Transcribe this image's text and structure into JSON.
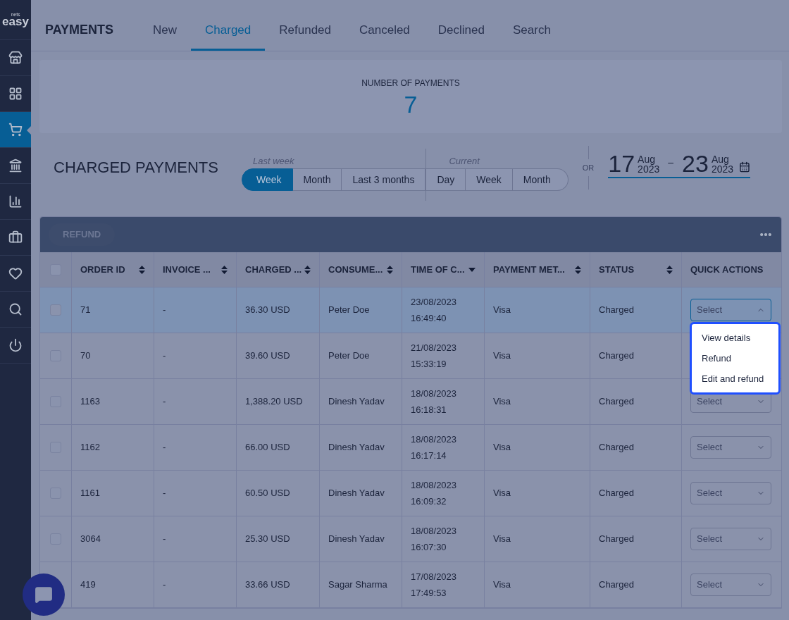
{
  "logo": {
    "small": "nets",
    "main": "easy"
  },
  "sidebar": {
    "items": [
      {
        "kind": "store",
        "selected": false
      },
      {
        "kind": "grid",
        "selected": false
      },
      {
        "kind": "cart",
        "selected": true
      },
      {
        "kind": "bank",
        "selected": false
      },
      {
        "kind": "chart",
        "selected": false
      },
      {
        "kind": "briefcase",
        "selected": false
      },
      {
        "kind": "heart",
        "selected": false
      },
      {
        "kind": "search",
        "selected": false
      },
      {
        "kind": "power",
        "selected": false
      }
    ]
  },
  "header": {
    "title": "PAYMENTS",
    "tabs": [
      {
        "label": "New",
        "selected": false
      },
      {
        "label": "Charged",
        "selected": true
      },
      {
        "label": "Refunded",
        "selected": false
      },
      {
        "label": "Canceled",
        "selected": false
      },
      {
        "label": "Declined",
        "selected": false
      },
      {
        "label": "Search",
        "selected": false
      }
    ]
  },
  "stats": {
    "label": "NUMBER OF PAYMENTS",
    "value": "7"
  },
  "section": {
    "title": "CHARGED PAYMENTS",
    "period_groups": [
      {
        "label": "Last week",
        "options": [
          {
            "label": "Week",
            "selected": true
          },
          {
            "label": "Month",
            "selected": false
          },
          {
            "label": "Last 3 months",
            "selected": false
          }
        ]
      },
      {
        "label": "Current",
        "options": [
          {
            "label": "Day",
            "selected": false
          },
          {
            "label": "Week",
            "selected": false
          },
          {
            "label": "Month",
            "selected": false
          }
        ]
      }
    ],
    "or": "OR",
    "date_range": {
      "from": {
        "day": "17",
        "month": "Aug",
        "year": "2023"
      },
      "separator": "–",
      "to": {
        "day": "23",
        "month": "Aug",
        "year": "2023"
      }
    }
  },
  "table": {
    "toolbar": {
      "refund": {
        "label": "REFUND",
        "disabled": true
      }
    },
    "select_all": {
      "checked": false
    },
    "columns": [
      {
        "label": "ORDER ID",
        "kind": "sortable"
      },
      {
        "label": "INVOICE ...",
        "kind": "sortable"
      },
      {
        "label": "CHARGED ...",
        "kind": "sortable"
      },
      {
        "label": "CONSUME...",
        "kind": "sortable"
      },
      {
        "label": "TIME OF C...",
        "kind": "sorted"
      },
      {
        "label": "PAYMENT MET...",
        "kind": "sortable"
      },
      {
        "label": "STATUS",
        "kind": "sortable"
      },
      {
        "label": "QUICK ACTIONS",
        "kind": "plain"
      }
    ],
    "rows": [
      {
        "checked": false,
        "highlighted": true,
        "order_id": "71",
        "invoice": "-",
        "charged": "36.30 USD",
        "consumer": "Peter Doe",
        "date": "23/08/2023",
        "time": "16:49:40",
        "method": "Visa",
        "status": "Charged",
        "action": {
          "label": "Select",
          "expanded": true,
          "options": [
            "View details",
            "Refund",
            "Edit and refund"
          ]
        }
      },
      {
        "checked": false,
        "highlighted": false,
        "order_id": "70",
        "invoice": "-",
        "charged": "39.60 USD",
        "consumer": "Peter Doe",
        "date": "21/08/2023",
        "time": "15:33:19",
        "method": "Visa",
        "status": "Charged"
      },
      {
        "checked": false,
        "highlighted": false,
        "order_id": "1163",
        "invoice": "-",
        "charged": "1,388.20 USD",
        "consumer": "Dinesh Yadav",
        "date": "18/08/2023",
        "time": "16:18:31",
        "method": "Visa",
        "status": "Charged",
        "action": {
          "label": "Select",
          "expanded": false
        }
      },
      {
        "checked": false,
        "highlighted": false,
        "order_id": "1162",
        "invoice": "-",
        "charged": "66.00 USD",
        "consumer": "Dinesh Yadav",
        "date": "18/08/2023",
        "time": "16:17:14",
        "method": "Visa",
        "status": "Charged",
        "action": {
          "label": "Select",
          "expanded": false
        }
      },
      {
        "checked": false,
        "highlighted": false,
        "order_id": "1161",
        "invoice": "-",
        "charged": "60.50 USD",
        "consumer": "Dinesh Yadav",
        "date": "18/08/2023",
        "time": "16:09:32",
        "method": "Visa",
        "status": "Charged",
        "action": {
          "label": "Select",
          "expanded": false
        }
      },
      {
        "checked": false,
        "highlighted": false,
        "order_id": "3064",
        "invoice": "-",
        "charged": "25.30 USD",
        "consumer": "Dinesh Yadav",
        "date": "18/08/2023",
        "time": "16:07:30",
        "method": "Visa",
        "status": "Charged",
        "action": {
          "label": "Select",
          "expanded": false
        }
      },
      {
        "highlighted": false,
        "order_id": "419",
        "invoice": "-",
        "charged": "33.66 USD",
        "consumer": "Sagar Sharma",
        "date": "17/08/2023",
        "time": "17:49:53",
        "method": "Visa",
        "status": "Charged",
        "action": {
          "label": "Select",
          "expanded": false
        }
      }
    ]
  }
}
